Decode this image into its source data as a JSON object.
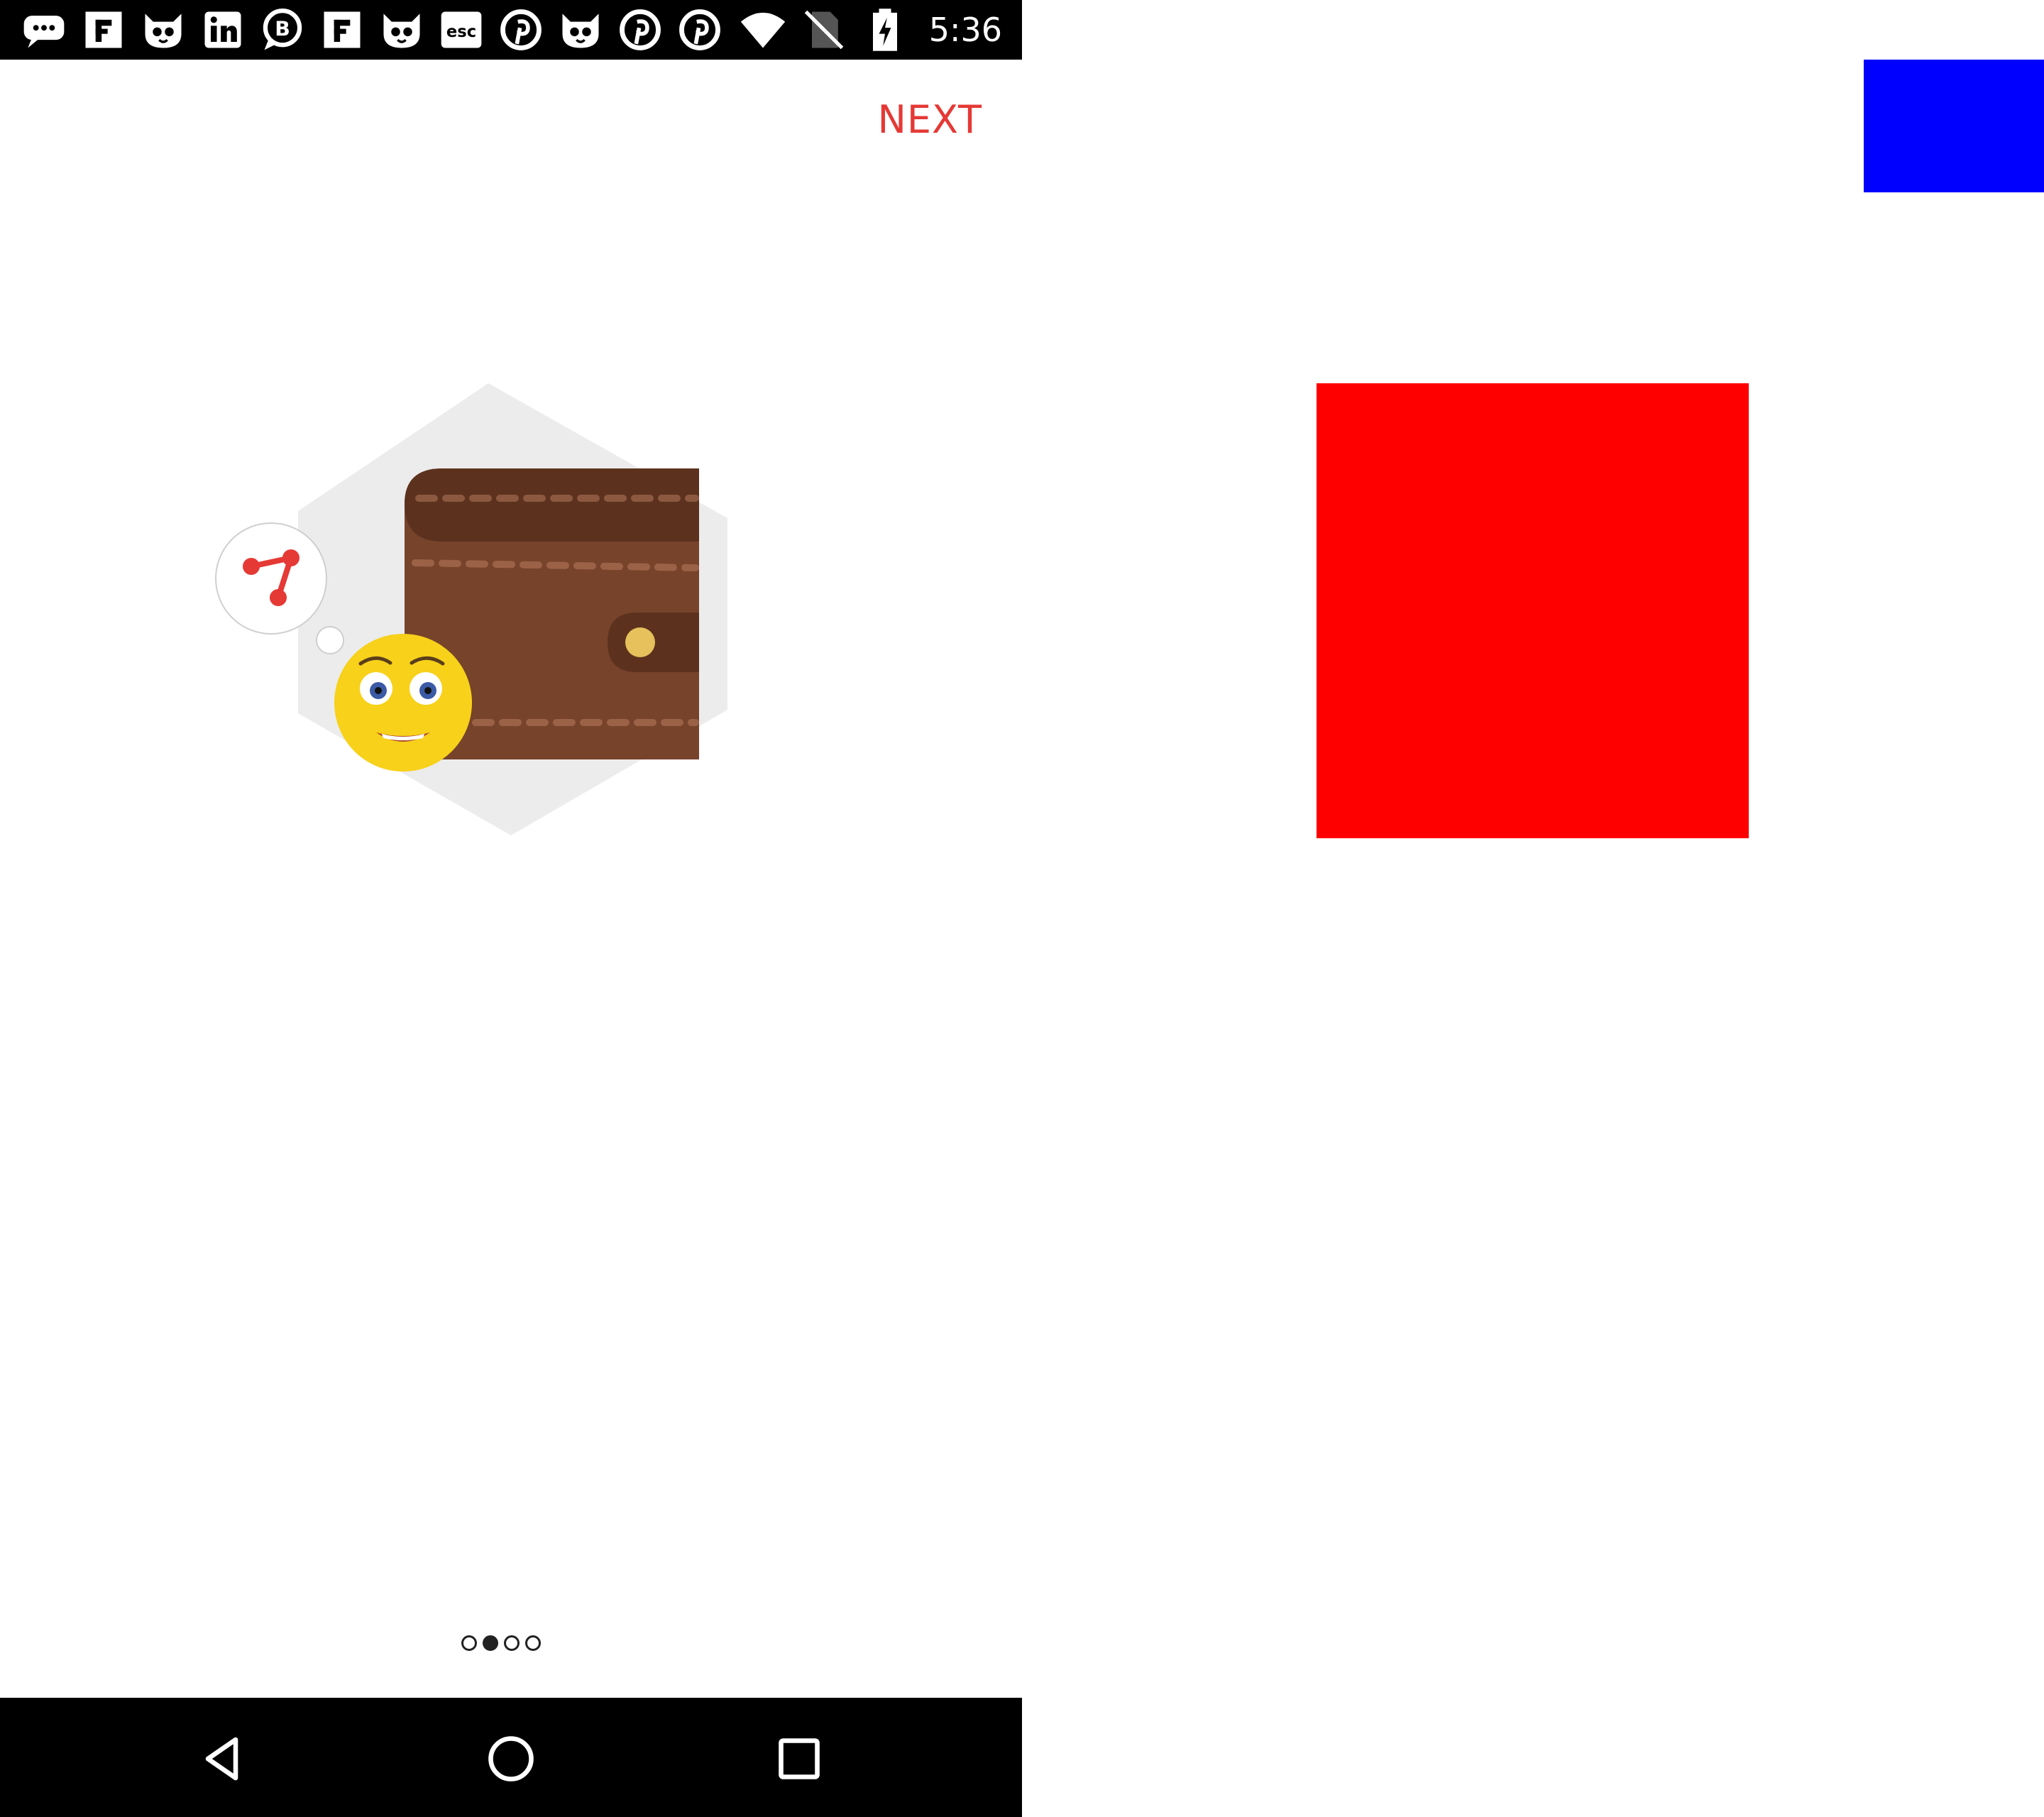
{
  "status_bar": {
    "time": "5:36",
    "notifications": [
      "chat-bubble-icon",
      "flipboard-icon",
      "cat-face-icon",
      "linkedin-icon",
      "beeline-chat-icon",
      "flipboard-icon",
      "cat-face-icon",
      "esc-icon",
      "pinterest-icon",
      "cat-face-icon",
      "pinterest-icon",
      "pinterest-icon"
    ],
    "esc_label": "esc",
    "system_icons": [
      "wifi-icon",
      "no-sim-icon",
      "battery-charging-icon"
    ]
  },
  "onboarding": {
    "next_label": "NEXT",
    "page_count": 4,
    "current_page": 2
  },
  "nav_bar": {
    "buttons": [
      "back-icon",
      "home-icon",
      "recents-icon"
    ]
  },
  "colors": {
    "accent": "#e53935",
    "red_block": "#ff0000",
    "blue_block": "#0000ff",
    "bar": "#000000"
  }
}
